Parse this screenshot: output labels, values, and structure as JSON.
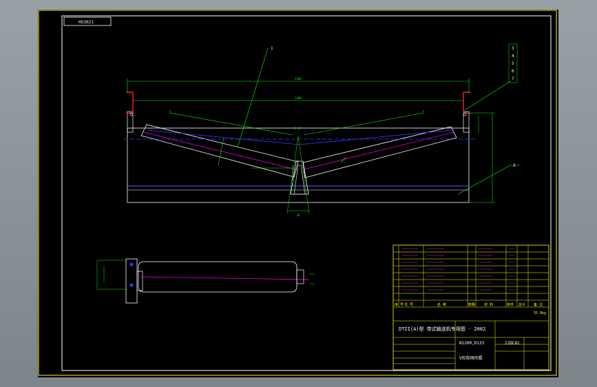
{
  "drawing": {
    "code_box": "HS3021",
    "part_labels": [
      "1",
      "2",
      "3",
      "4",
      "5",
      "6",
      "7"
    ],
    "dims": {
      "overall": "1580",
      "inner": "1468",
      "angle": "R 35°",
      "gap": "10"
    },
    "title_block": {
      "series": "DTII(A)型  带式输送机专用图 - 2002",
      "model": "B1200,D133",
      "code": "12DC81",
      "name": "V形前倾托辊",
      "header": [
        "序 号",
        "代 号",
        "名 称",
        "数量",
        "材 料",
        "单件",
        "总计",
        "备 注"
      ],
      "total_weight": "55.9kg"
    }
  },
  "colors": {
    "frame": "#ffff00",
    "outline": "#ffffff",
    "dimension": "#00ff00",
    "centerline": "#ff00ff",
    "hidden": "#0000ff",
    "marker": "#ff0000"
  }
}
